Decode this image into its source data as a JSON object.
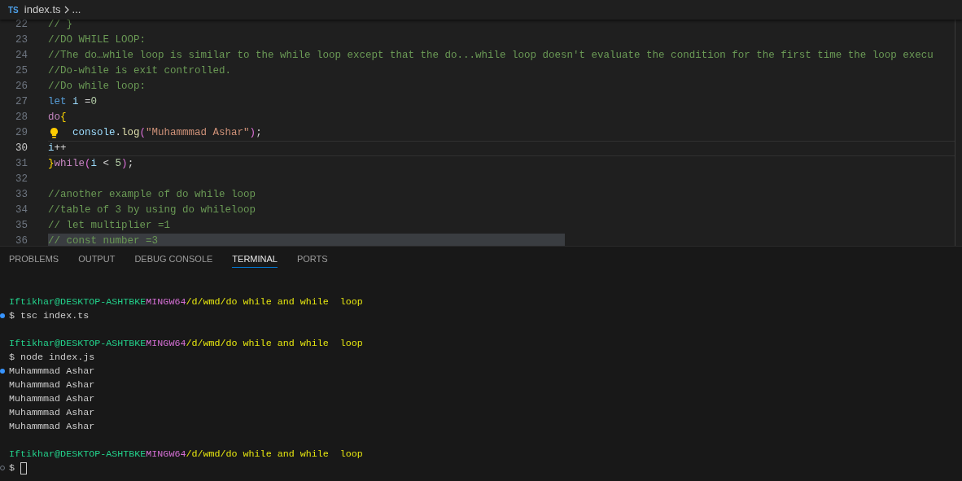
{
  "breadcrumb": {
    "badge": "TS",
    "file": "index.ts",
    "more": "..."
  },
  "editor": {
    "lines": [
      {
        "number": "22",
        "current": false,
        "highlighted": false,
        "lightbulb": false,
        "tokens": [
          {
            "kind": "comment",
            "text": "// }"
          }
        ]
      },
      {
        "number": "23",
        "current": false,
        "highlighted": false,
        "lightbulb": false,
        "tokens": [
          {
            "kind": "comment",
            "text": "//DO WHILE LOOP:"
          }
        ]
      },
      {
        "number": "24",
        "current": false,
        "highlighted": false,
        "lightbulb": false,
        "tokens": [
          {
            "kind": "comment",
            "text": "//The do…while loop is similar to the while loop except that the do...while loop doesn't evaluate the condition for the first time the loop execu"
          }
        ]
      },
      {
        "number": "25",
        "current": false,
        "highlighted": false,
        "lightbulb": false,
        "tokens": [
          {
            "kind": "comment",
            "text": "//Do-while is exit controlled."
          }
        ]
      },
      {
        "number": "26",
        "current": false,
        "highlighted": false,
        "lightbulb": false,
        "tokens": [
          {
            "kind": "comment",
            "text": "//Do while loop:"
          }
        ]
      },
      {
        "number": "27",
        "current": false,
        "highlighted": false,
        "lightbulb": false,
        "tokens": [
          {
            "kind": "keyword",
            "text": "let "
          },
          {
            "kind": "variable",
            "text": "i"
          },
          {
            "kind": "plain",
            "text": " ="
          },
          {
            "kind": "number",
            "text": "0"
          }
        ]
      },
      {
        "number": "28",
        "current": false,
        "highlighted": false,
        "lightbulb": false,
        "tokens": [
          {
            "kind": "control",
            "text": "do"
          },
          {
            "kind": "bracket",
            "text": "{"
          }
        ]
      },
      {
        "number": "29",
        "current": false,
        "highlighted": false,
        "lightbulb": true,
        "tokens": [
          {
            "kind": "variable",
            "text": "    console"
          },
          {
            "kind": "plain",
            "text": "."
          },
          {
            "kind": "function",
            "text": "log"
          },
          {
            "kind": "paren",
            "text": "("
          },
          {
            "kind": "string",
            "text": "\"Muhammmad Ashar\""
          },
          {
            "kind": "paren",
            "text": ")"
          },
          {
            "kind": "plain",
            "text": ";"
          }
        ]
      },
      {
        "number": "30",
        "current": true,
        "highlighted": false,
        "lightbulb": false,
        "tokens": [
          {
            "kind": "variable",
            "text": "i"
          },
          {
            "kind": "plain",
            "text": "++"
          }
        ]
      },
      {
        "number": "31",
        "current": false,
        "highlighted": false,
        "lightbulb": false,
        "tokens": [
          {
            "kind": "bracket",
            "text": "}"
          },
          {
            "kind": "control",
            "text": "while"
          },
          {
            "kind": "paren",
            "text": "("
          },
          {
            "kind": "variable",
            "text": "i"
          },
          {
            "kind": "plain",
            "text": " < "
          },
          {
            "kind": "number",
            "text": "5"
          },
          {
            "kind": "paren",
            "text": ")"
          },
          {
            "kind": "plain",
            "text": ";"
          }
        ]
      },
      {
        "number": "32",
        "current": false,
        "highlighted": false,
        "lightbulb": false
      },
      {
        "number": "33",
        "current": false,
        "highlighted": false,
        "lightbulb": false,
        "tokens": [
          {
            "kind": "comment",
            "text": "//another example of do while loop"
          }
        ]
      },
      {
        "number": "34",
        "current": false,
        "highlighted": false,
        "lightbulb": false,
        "tokens": [
          {
            "kind": "comment",
            "text": "//table of 3 by using do whileloop"
          }
        ]
      },
      {
        "number": "35",
        "current": false,
        "highlighted": false,
        "lightbulb": false,
        "tokens": [
          {
            "kind": "comment",
            "text": "// let multiplier =1"
          }
        ]
      },
      {
        "number": "36",
        "current": false,
        "highlighted": true,
        "lightbulb": false,
        "tokens": [
          {
            "kind": "comment",
            "text": "// const number =3"
          }
        ]
      }
    ]
  },
  "panel": {
    "tabs": [
      {
        "label": "PROBLEMS",
        "selected": false
      },
      {
        "label": "OUTPUT",
        "selected": false
      },
      {
        "label": "DEBUG CONSOLE",
        "selected": false
      },
      {
        "label": "TERMINAL",
        "selected": true
      },
      {
        "label": "PORTS",
        "selected": false
      }
    ]
  },
  "terminal": {
    "lines": [
      {
        "kind": "prompt",
        "user": "Iftikhar@DESKTOP-ASHTBKE",
        "shell": "MINGW64",
        "path": "/d/wmd/do while and while  loop"
      },
      {
        "kind": "command",
        "decoration": {
          "kind": "success"
        },
        "text": "$ tsc index.ts"
      },
      {
        "kind": "blank"
      },
      {
        "kind": "prompt",
        "user": "Iftikhar@DESKTOP-ASHTBKE",
        "shell": "MINGW64",
        "path": "/d/wmd/do while and while  loop"
      },
      {
        "kind": "command",
        "text": "$ node index.js"
      },
      {
        "kind": "output",
        "decoration": {
          "kind": "success"
        },
        "text": "Muhammmad Ashar"
      },
      {
        "kind": "output",
        "text": "Muhammmad Ashar"
      },
      {
        "kind": "output",
        "text": "Muhammmad Ashar"
      },
      {
        "kind": "output",
        "text": "Muhammmad Ashar"
      },
      {
        "kind": "output",
        "text": "Muhammmad Ashar"
      },
      {
        "kind": "blank"
      },
      {
        "kind": "prompt",
        "user": "Iftikhar@DESKTOP-ASHTBKE",
        "shell": "MINGW64",
        "path": "/d/wmd/do while and while  loop"
      },
      {
        "kind": "input",
        "decoration": {
          "kind": "pending"
        },
        "text": "$"
      }
    ]
  }
}
